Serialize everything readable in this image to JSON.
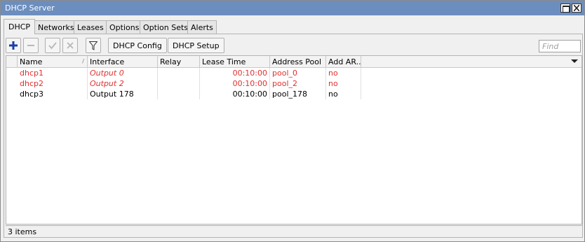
{
  "window": {
    "title": "DHCP Server"
  },
  "tabs": [
    {
      "label": "DHCP"
    },
    {
      "label": "Networks"
    },
    {
      "label": "Leases"
    },
    {
      "label": "Options"
    },
    {
      "label": "Option Sets"
    },
    {
      "label": "Alerts"
    }
  ],
  "toolbar": {
    "add_icon": "plus-icon",
    "remove_icon": "minus-icon",
    "enable_icon": "check-icon",
    "disable_icon": "x-icon",
    "filter_icon": "filter-icon",
    "dhcp_config_label": "DHCP Config",
    "dhcp_setup_label": "DHCP Setup",
    "find_placeholder": "Find"
  },
  "table": {
    "columns": [
      "Name",
      "Interface",
      "Relay",
      "Lease Time",
      "Address Pool",
      "Add AR..."
    ],
    "rows": [
      {
        "name": "dhcp1",
        "interface": "Output 0",
        "relay": "",
        "lease_time": "00:10:00",
        "address_pool": "pool_0",
        "add_arp": "no",
        "disabled": true
      },
      {
        "name": "dhcp2",
        "interface": "Output 2",
        "relay": "",
        "lease_time": "00:10:00",
        "address_pool": "pool_2",
        "add_arp": "no",
        "disabled": true
      },
      {
        "name": "dhcp3",
        "interface": "Output 178",
        "relay": "",
        "lease_time": "00:10:00",
        "address_pool": "pool_178",
        "add_arp": "no",
        "disabled": false
      }
    ]
  },
  "status": {
    "items_text": "3 items"
  },
  "colors": {
    "titlebar": "#6c8ebf",
    "disabled_text": "#e03030",
    "add_icon": "#1a3fa8"
  }
}
